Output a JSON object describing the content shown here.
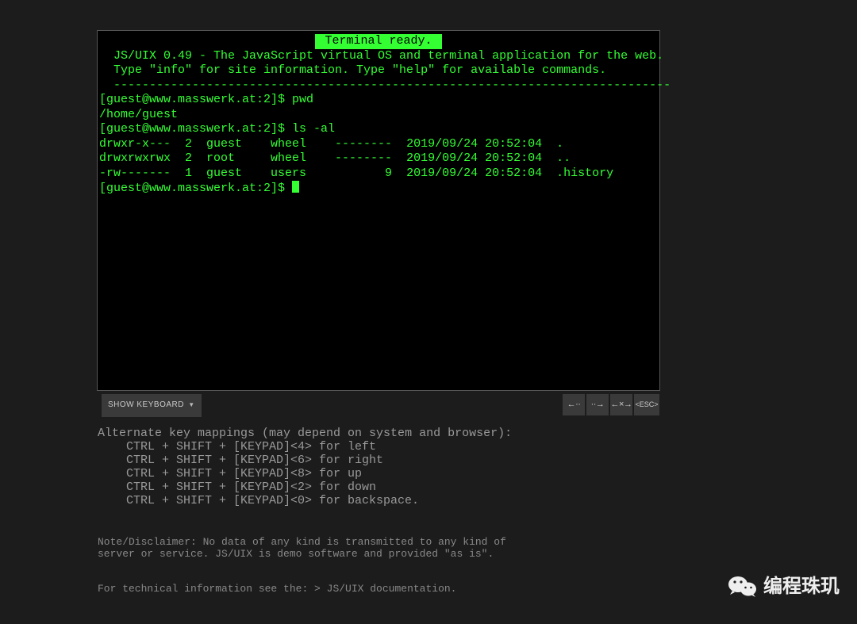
{
  "terminal": {
    "title": "Terminal ready.",
    "intro1": " JS/UIX 0.49 - The JavaScript virtual OS and terminal application for the web.",
    "intro2": " Type \"info\" for site information. Type \"help\" for available commands.",
    "divider": " ------------------------------------------------------------------------------",
    "prompt": "[guest@www.masswerk.at:2]$ ",
    "cmd1": "pwd",
    "out1": "/home/guest",
    "cmd2": "ls -al",
    "ls1": "drwxr-x---  2  guest    wheel    --------  2019/09/24 20:52:04  .",
    "ls2": "drwxrwxrwx  2  root     wheel    --------  2019/09/24 20:52:04  ..",
    "ls3": "-rw-------  1  guest    users           9  2019/09/24 20:52:04  .history"
  },
  "toolbar": {
    "show_kb": "SHOW KEYBOARD",
    "btn_back": "←··",
    "btn_fwd": "··→",
    "btn_swap": "←×→",
    "btn_esc": "<ESC>"
  },
  "info": {
    "heading": "Alternate key mappings (may depend on system and browser):",
    "m1": "CTRL + SHIFT + [KEYPAD]<4> for left",
    "m2": "CTRL + SHIFT + [KEYPAD]<6> for right",
    "m3": "CTRL + SHIFT + [KEYPAD]<8> for up",
    "m4": "CTRL + SHIFT + [KEYPAD]<2> for down",
    "m5": "CTRL + SHIFT + [KEYPAD]<0> for backspace.",
    "note1": "Note/Disclaimer: No data of any kind is transmitted to any kind of",
    "note2": "server or service. JS/UIX is demo software and provided \"as is\".",
    "doclink": "For technical information see the: > JS/UIX documentation."
  },
  "watermark": {
    "text": "编程珠玑"
  }
}
